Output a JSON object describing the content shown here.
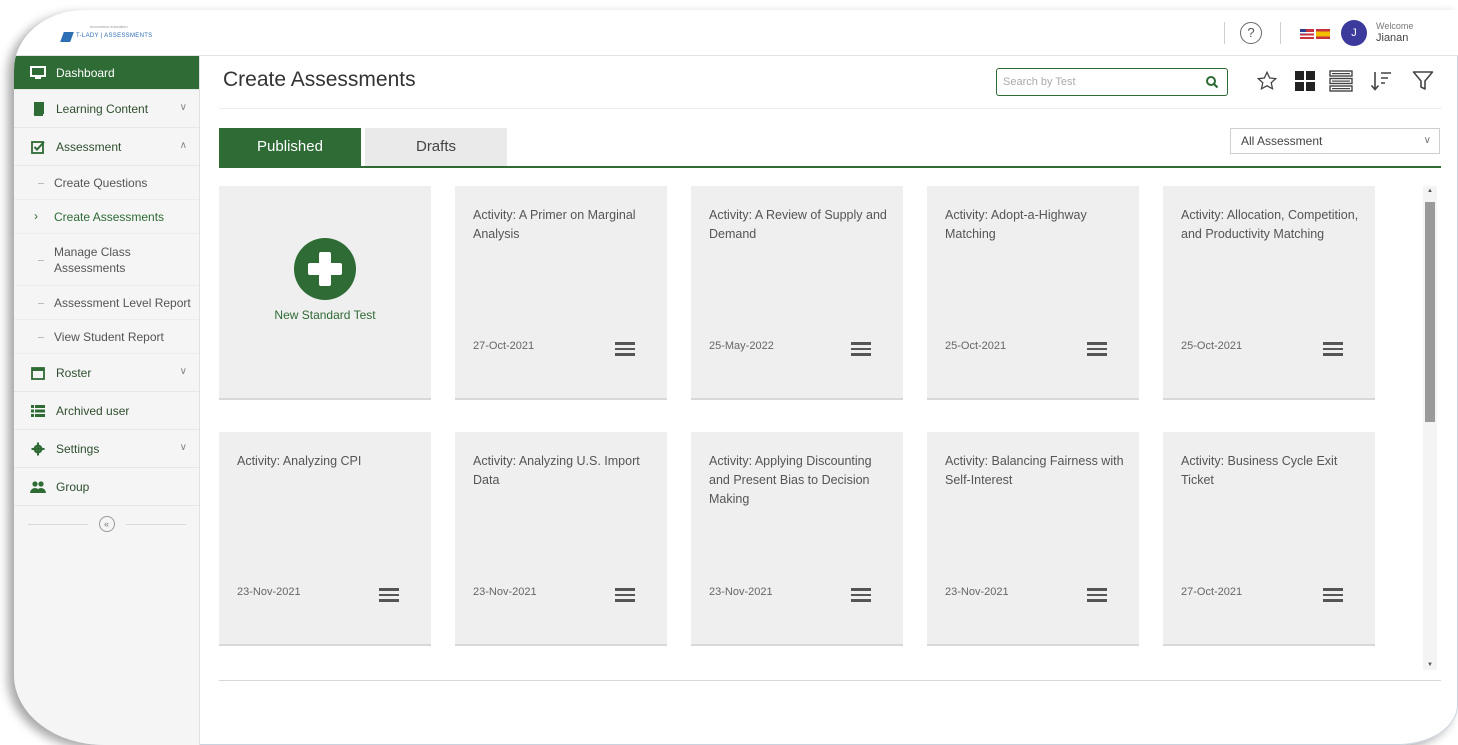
{
  "header": {
    "logo_small": "economics education",
    "logo_text": "T-LADY | ASSESSMENTS",
    "help_glyph": "?",
    "avatar_initial": "J",
    "welcome": "Welcome",
    "user_name": "Jianan"
  },
  "sidebar": {
    "dashboard": "Dashboard",
    "learning_content": "Learning Content",
    "assessment": "Assessment",
    "sub": {
      "create_questions": "Create Questions",
      "create_assessments": "Create Assessments",
      "manage_class": "Manage Class Assessments",
      "level_report": "Assessment Level Report",
      "student_report": "View Student Report"
    },
    "roster": "Roster",
    "archived": "Archived user",
    "settings": "Settings",
    "group": "Group",
    "collapse_glyph": "«"
  },
  "main": {
    "title": "Create Assessments",
    "search_placeholder": "Search by Test",
    "tabs": {
      "published": "Published",
      "drafts": "Drafts"
    },
    "filter_selected": "All Assessment",
    "new_test_label": "New Standard Test"
  },
  "cards": [
    {
      "title": "Activity: A Primer on Marginal Analysis",
      "date": "27-Oct-2021"
    },
    {
      "title": "Activity: A Review of Supply and Demand",
      "date": "25-May-2022"
    },
    {
      "title": "Activity: Adopt-a-Highway Matching",
      "date": "25-Oct-2021"
    },
    {
      "title": "Activity: Allocation, Competition, and Productivity Matching",
      "date": "25-Oct-2021"
    },
    {
      "title": "Activity: Analyzing CPI",
      "date": "23-Nov-2021"
    },
    {
      "title": "Activity: Analyzing U.S. Import Data",
      "date": "23-Nov-2021"
    },
    {
      "title": "Activity: Applying Discounting and Present Bias to Decision Making",
      "date": "23-Nov-2021"
    },
    {
      "title": "Activity: Balancing Fairness with Self-Interest",
      "date": "23-Nov-2021"
    },
    {
      "title": "Activity: Business Cycle Exit Ticket",
      "date": "27-Oct-2021"
    }
  ],
  "colors": {
    "brand_green": "#2e6b35",
    "avatar": "#3c3a9d"
  },
  "icons": [
    "help-icon",
    "flag-icon",
    "search-icon",
    "star-icon",
    "grid-view-icon",
    "list-view-icon",
    "sort-icon",
    "filter-icon",
    "plus-icon",
    "menu-icon"
  ]
}
